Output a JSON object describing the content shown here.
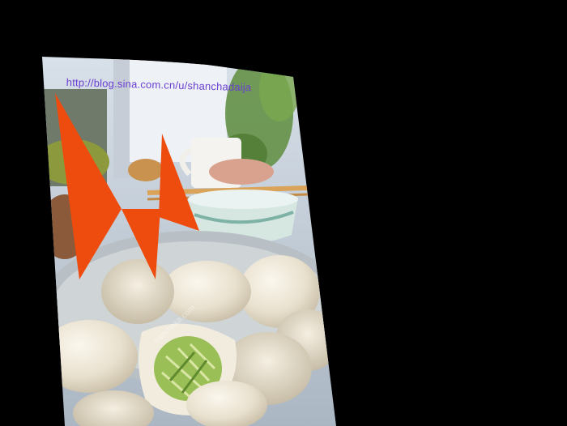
{
  "photo": {
    "caption_url": "http://blog.sina.com.cn/u/shanchadaija",
    "watermark_text": "sanchaka.com"
  },
  "colors": {
    "background": "#000000",
    "logo_orange": "#ee4c0e",
    "url_text": "#6a3fd2"
  },
  "icons": {
    "logo": "orange-m-logo-icon"
  }
}
